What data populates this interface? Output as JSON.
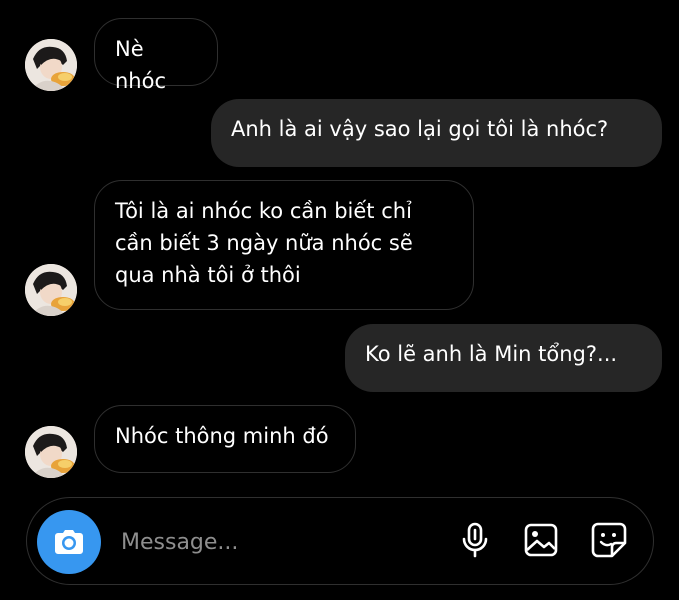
{
  "messages": [
    {
      "side": "in",
      "text": "Nè nhóc",
      "avatar": "user-avatar"
    },
    {
      "side": "out",
      "text": "Anh là ai vậy sao lại gọi tôi là nhóc?"
    },
    {
      "side": "in",
      "text": "Tôi là ai nhóc ko cần biết chỉ cần biết 3 ngày nữa nhóc sẽ qua nhà tôi ở thôi",
      "avatar": "user-avatar"
    },
    {
      "side": "out",
      "text": "Ko lẽ anh là Min tổng?..."
    },
    {
      "side": "in",
      "text": "Nhóc thông minh đó",
      "avatar": "user-avatar"
    }
  ],
  "composer": {
    "placeholder": "Message...",
    "value": "",
    "icons": [
      "camera-icon",
      "microphone-icon",
      "image-icon",
      "sticker-icon"
    ]
  },
  "colors": {
    "background": "#000000",
    "outgoing_bubble": "#262626",
    "incoming_border": "#2f2f2f",
    "camera_button": "#3797f0",
    "placeholder": "#8e8e8e"
  }
}
